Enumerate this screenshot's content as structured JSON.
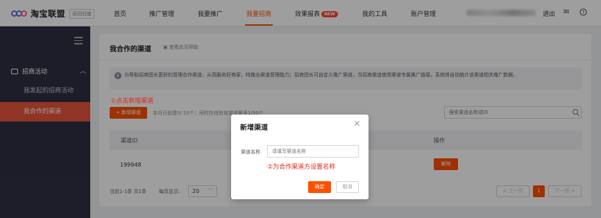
{
  "header": {
    "logo_text": "淘宝联盟",
    "old_version_label": "返回旧版",
    "nav": [
      {
        "label": "首页"
      },
      {
        "label": "推广管理"
      },
      {
        "label": "我要推广"
      },
      {
        "label": "我要招商"
      },
      {
        "label": "效果报表",
        "badge": "NEW"
      },
      {
        "label": "我的工具"
      },
      {
        "label": "账户管理"
      }
    ],
    "active_nav": "我要招商",
    "logout_label": "退出",
    "icons": [
      "mail-icon",
      "help-icon"
    ]
  },
  "sidebar": {
    "menu_icon": "hamburger-icon",
    "group_label": "招商活动",
    "items": [
      {
        "label": "我发起的招商活动"
      },
      {
        "label": "我合作的渠道",
        "active": true
      }
    ]
  },
  "main": {
    "title": "我合作的渠道",
    "help_link": "查看此页帮助",
    "info_text": "为帮助招商团长更好的管理合作渠道，从而服务好商家，特推出渠道管理能力；招商团长可自定义推广渠道，当招商渠道使用渠道专属推广链接，系统将自动统计该渠道相关推广数据。",
    "annotation_1": "①点击新增渠道",
    "add_button": "+ 新增渠道",
    "note": "本月已创建0/ 50个；同时在线有效渠道最多1/50个",
    "search_placeholder": "搜索渠道名称或ID",
    "table": {
      "columns": [
        "渠道ID",
        "操作"
      ],
      "rows": [
        {
          "id": "199948",
          "action": "删除"
        }
      ]
    },
    "footer": {
      "summary": "当前1-1条 共1条",
      "page_size_label": "每页显示:",
      "page_size": "20",
      "prev": "< 上一页",
      "current_page": "1",
      "next": "下一页 >"
    }
  },
  "modal": {
    "title": "新增渠道",
    "field_label": "渠道名称",
    "field_placeholder": "请填写渠道名称",
    "annotation_2": "②为合作渠道方设置名称",
    "confirm": "确定",
    "cancel": "取消"
  },
  "colors": {
    "accent": "#ff5000",
    "sidebar_bg": "#2f3044",
    "sidebar_active": "#e8543d",
    "annotation": "#e0241b"
  }
}
